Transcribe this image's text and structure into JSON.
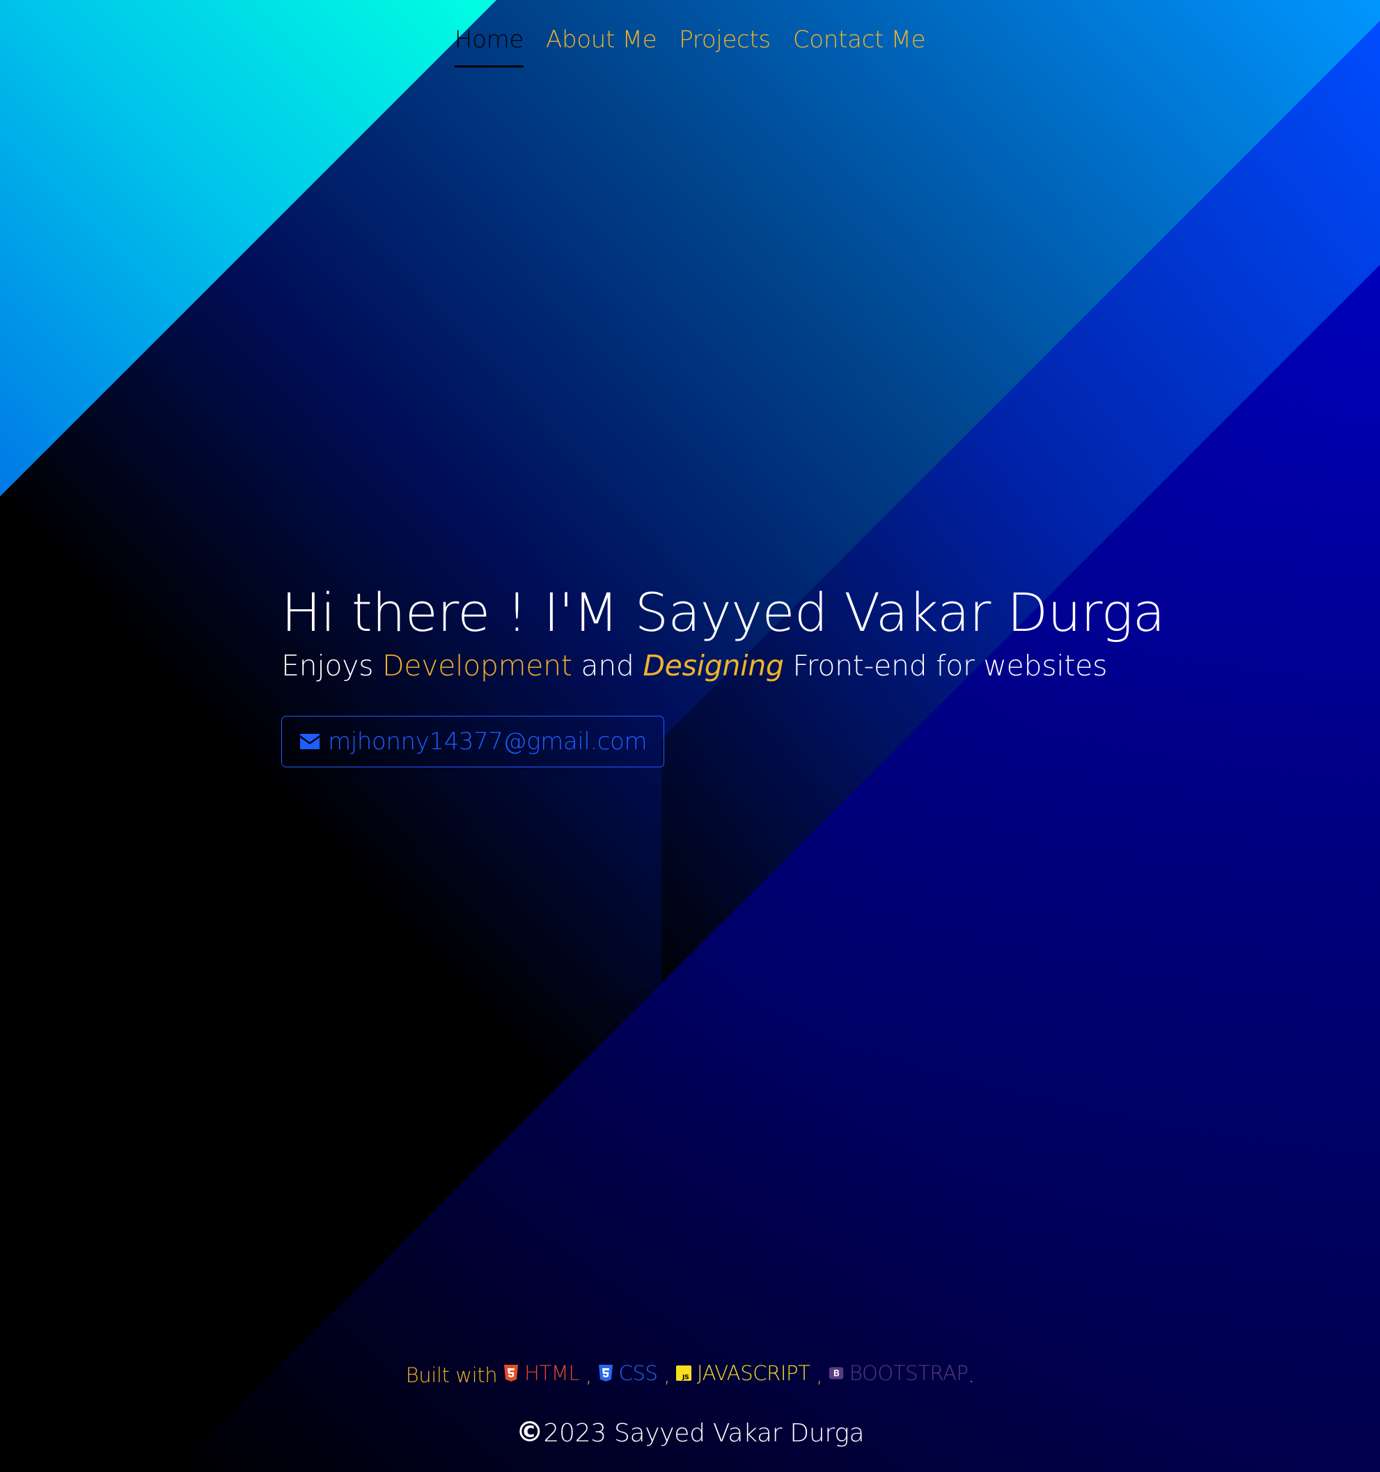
{
  "nav": {
    "items": [
      {
        "label": "Home",
        "active": true
      },
      {
        "label": "About Me",
        "active": false
      },
      {
        "label": "Projects",
        "active": false
      },
      {
        "label": "Contact Me",
        "active": false
      }
    ]
  },
  "hero": {
    "title": "Hi there ! I'M Sayyed Vakar Durga",
    "subtitle": {
      "part1": "Enjoys ",
      "highlight1": "Development",
      "part2": " and ",
      "highlight2": "Designing",
      "part3": " Front-end for websites"
    },
    "email_button": {
      "icon": "envelope-icon",
      "label": "mjhonny14377@gmail.com"
    }
  },
  "footer": {
    "built_with_label": "Built with",
    "technologies": [
      {
        "icon": "html5-icon",
        "label": "HTML",
        "color": "#e34c26",
        "sep": " ,"
      },
      {
        "icon": "css3-icon",
        "label": "CSS",
        "color": "#2965f1",
        "sep": " ,"
      },
      {
        "icon": "js-icon",
        "label": "JAVASCRIPT",
        "color": "#f7df1e",
        "sep": " ,"
      },
      {
        "icon": "bootstrap-icon",
        "label": "BOOTSTRAP",
        "color": "#563d7c",
        "sep": "."
      }
    ],
    "copyright_symbol": "©",
    "copyright_text": "2023 Sayyed Vakar Durga"
  },
  "colors": {
    "accent": "#f0b429",
    "link_blue": "#1e5eff",
    "background": "#000000",
    "cyan": "#00ffe1",
    "royal_blue": "#0000d2"
  }
}
